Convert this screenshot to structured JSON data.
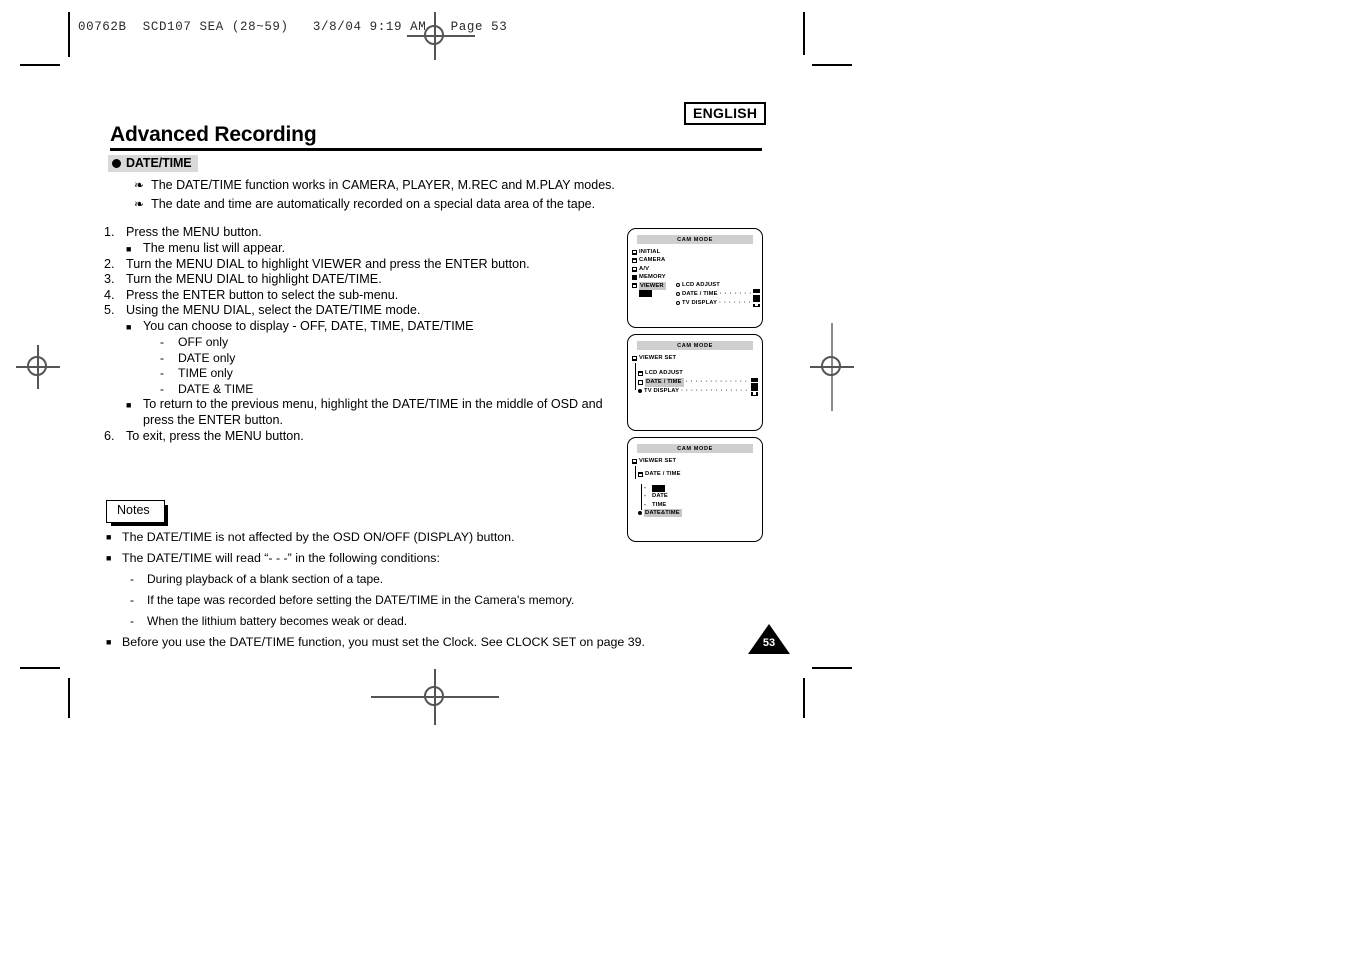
{
  "print_header": {
    "code_line": "00762B  SCD107 SEA (28~59)   3/8/04 9:19 AM   Page 53"
  },
  "header": {
    "language_badge": "ENGLISH",
    "title": "Advanced Recording"
  },
  "section": {
    "bullet_icon": "filled-circle-icon",
    "heading": "DATE/TIME",
    "intro_bullets": [
      "The DATE/TIME function works in CAMERA, PLAYER, M.REC and M.PLAY modes.",
      "The date and time are automatically recorded on a special data area of the tape."
    ]
  },
  "steps": [
    {
      "num": "1.",
      "text": "Press the MENU button."
    },
    {
      "num": "2.",
      "text": "Turn the MENU DIAL to highlight VIEWER and  press the ENTER button."
    },
    {
      "num": "3.",
      "text": "Turn the MENU DIAL to highlight DATE/TIME."
    },
    {
      "num": "4.",
      "text": "Press the ENTER button to select the sub-menu."
    },
    {
      "num": "5.",
      "text": "Using the MENU DIAL, select the DATE/TIME mode."
    },
    {
      "num": "6.",
      "text": "To exit, press the MENU button."
    }
  ],
  "step_subs": {
    "step1_sub": "The menu list will appear.",
    "step5_sub1": "You can choose to display - OFF, DATE, TIME, DATE/TIME",
    "step5_options": [
      "OFF only",
      "DATE only",
      "TIME only",
      "DATE & TIME"
    ],
    "step5_sub2_line1": "To return to the previous menu, highlight the DATE/TIME in the middle of OSD and",
    "step5_sub2_line2": "press the ENTER button."
  },
  "notes": {
    "label": "Notes",
    "items": [
      "The DATE/TIME is not affected by the OSD ON/OFF (DISPLAY) button.",
      "The DATE/TIME will read “- - -” in the following conditions:"
    ],
    "sub_items": [
      "During playback of a blank section of a tape.",
      "If the tape was recorded before setting the DATE/TIME in the Camera's memory.",
      "When the lithium battery becomes weak or dead."
    ],
    "last_item": "Before you use the DATE/TIME function, you must set the Clock. See CLOCK SET on page 39."
  },
  "page_number": "53",
  "osd_screens": [
    {
      "title": "CAM MODE",
      "left_items": [
        {
          "label": "INITIAL",
          "icon": "folder-icon",
          "highlight": false
        },
        {
          "label": "CAMERA",
          "icon": "folder-icon",
          "highlight": false
        },
        {
          "label": "A/V",
          "icon": "folder-icon",
          "highlight": false
        },
        {
          "label": "MEMORY",
          "icon": "folder-solid-icon",
          "highlight": false
        },
        {
          "label": "VIEWER",
          "icon": "folder-icon",
          "highlight": true
        }
      ],
      "right_items": [
        {
          "label": "LCD ADJUST",
          "icon": "diamond-icon",
          "dots": "",
          "indicator": false
        },
        {
          "label": "DATE / TIME",
          "icon": "diamond-icon",
          "dots": "· · · · · · · ·",
          "indicator": true
        },
        {
          "label": "TV DISPLAY",
          "icon": "diamond-icon",
          "dots": "· · · · · · · ·",
          "indicator": true
        }
      ],
      "cursor_block": true
    },
    {
      "title": "CAM MODE",
      "root_label": "VIEWER SET",
      "rows": [
        {
          "label": "LCD ADJUST",
          "icon": "folder-icon",
          "dots": "",
          "indicator": false,
          "highlight": false
        },
        {
          "label": "DATE / TIME",
          "icon": "folder-icon",
          "dots": "· · · · · · · · · · · · · · · ·",
          "indicator": true,
          "highlight": true
        },
        {
          "label": "TV DISPLAY",
          "icon": "diamond-solid-icon",
          "dots": "· · · · · · · · · · · · · · · ·",
          "indicator": true,
          "highlight": false
        }
      ]
    },
    {
      "title": "CAM MODE",
      "root_label": "VIEWER SET",
      "sub_label": "DATE / TIME",
      "options": [
        {
          "label": "",
          "icon": "dash-icon",
          "highlight": false,
          "black_block": true
        },
        {
          "label": "DATE",
          "icon": "dash-icon",
          "highlight": false,
          "black_block": false
        },
        {
          "label": "TIME",
          "icon": "dash-icon",
          "highlight": false,
          "black_block": false
        },
        {
          "label": "DATE&TIME",
          "icon": "diamond-solid-icon",
          "highlight": true,
          "black_block": false
        }
      ]
    }
  ]
}
